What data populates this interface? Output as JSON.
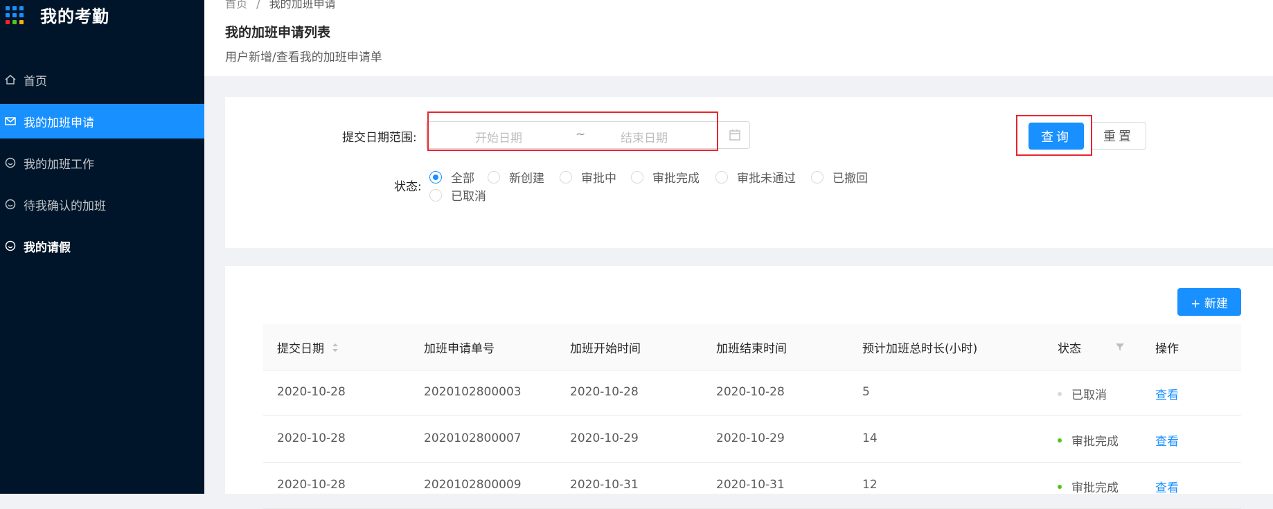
{
  "app": {
    "title": "我的考勤"
  },
  "sidebar": {
    "items": [
      {
        "label": "首页",
        "icon": "home-icon"
      },
      {
        "label": "我的加班申请",
        "icon": "mail-icon",
        "active": true
      },
      {
        "label": "我的加班工作",
        "icon": "smile-icon"
      },
      {
        "label": "待我确认的加班",
        "icon": "smile-icon"
      },
      {
        "label": "我的请假",
        "icon": "smile-icon"
      }
    ]
  },
  "breadcrumb": {
    "home": "首页",
    "separator": "/",
    "current": "我的加班申请"
  },
  "header": {
    "title": "我的加班申请列表",
    "subtitle": "用户新增/查看我的加班申请单"
  },
  "search": {
    "date_label": "提交日期范围:",
    "start_placeholder": "开始日期",
    "tilde": "~",
    "end_placeholder": "结束日期",
    "status_label": "状态:",
    "status_options": [
      "全部",
      "新创建",
      "审批中",
      "审批完成",
      "审批未通过",
      "已撤回",
      "已取消"
    ],
    "status_selected": "全部",
    "query_label": "查询",
    "reset_label": "重置"
  },
  "table": {
    "new_label": "+ 新建",
    "columns": [
      "提交日期",
      "加班申请单号",
      "加班开始时间",
      "加班结束时间",
      "预计加班总时长(小时)",
      "状态",
      "操作"
    ],
    "rows": [
      {
        "submit_date": "2020-10-28",
        "number": "2020102800003",
        "start": "2020-10-28",
        "end": "2020-10-28",
        "hours": "5",
        "status": "已取消",
        "status_color": "#d9d9d9",
        "action": "查看"
      },
      {
        "submit_date": "2020-10-28",
        "number": "2020102800007",
        "start": "2020-10-29",
        "end": "2020-10-29",
        "hours": "14",
        "status": "审批完成",
        "status_color": "#52c41a",
        "action": "查看"
      },
      {
        "submit_date": "2020-10-28",
        "number": "2020102800009",
        "start": "2020-10-31",
        "end": "2020-10-31",
        "hours": "12",
        "status": "审批完成",
        "status_color": "#52c41a",
        "action": "查看"
      }
    ]
  },
  "colors": {
    "primary": "#1890ff",
    "sidebar_bg": "#001529",
    "highlight": "#e8242d"
  }
}
